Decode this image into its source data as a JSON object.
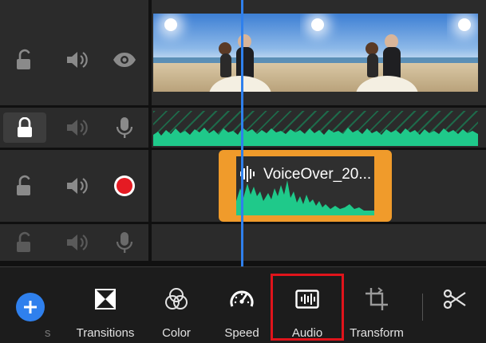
{
  "colors": {
    "accent": "#2f80ed",
    "voiceover_clip": "#f09b2b",
    "waveform": "#1fc98a",
    "record": "#e51b23",
    "highlight": "#e0141b"
  },
  "tracks": [
    {
      "icons": [
        "lock-open-icon",
        "speaker-icon",
        "eye-icon"
      ]
    },
    {
      "icons": [
        "lock-closed-icon",
        "speaker-icon",
        "microphone-icon"
      ]
    },
    {
      "icons": [
        "lock-open-icon",
        "speaker-icon",
        "record-icon"
      ]
    },
    {
      "icons": [
        "lock-open-icon",
        "speaker-icon",
        "microphone-icon"
      ]
    }
  ],
  "clips": {
    "voiceover_name": "VoiceOver_20..."
  },
  "toolbar": {
    "partial_label": "s",
    "tools": [
      {
        "label": "Transitions",
        "icon": "transitions-icon"
      },
      {
        "label": "Color",
        "icon": "color-icon"
      },
      {
        "label": "Speed",
        "icon": "speed-icon"
      },
      {
        "label": "Audio",
        "icon": "audio-icon"
      },
      {
        "label": "Transform",
        "icon": "transform-icon"
      }
    ],
    "scissors_icon": "scissors-icon"
  }
}
